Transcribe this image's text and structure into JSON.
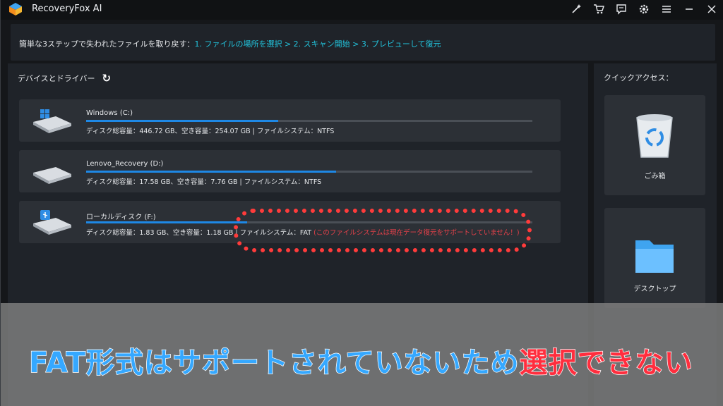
{
  "app": {
    "title": "RecoveryFox AI"
  },
  "titlebar": {
    "icons": [
      "magic-wand-icon",
      "cart-icon",
      "chat-icon",
      "gear-icon",
      "menu-icon",
      "minimize-icon",
      "close-icon"
    ]
  },
  "steps": {
    "prefix": "簡単な3ステップで失われたファイルを取り戻す：",
    "path": "1. ファイルの場所を選択 > 2. スキャン開始 > 3. プレビューして復元"
  },
  "devices": {
    "title": "デバイスとドライバー",
    "drives": [
      {
        "name": "Windows (C:)",
        "info": "ディスク総容量：446.72 GB、空き容量：254.07 GB | ファイルシステム：NTFS",
        "used_fraction": 0.43,
        "icon": "windows-drive-icon",
        "warning": ""
      },
      {
        "name": "Lenovo_Recovery (D:)",
        "info": "ディスク総容量：17.58 GB、空き容量：7.76 GB | ファイルシステム：NTFS",
        "used_fraction": 0.56,
        "icon": "hard-drive-icon",
        "warning": ""
      },
      {
        "name": "ローカルディスク (F:)",
        "info": "ディスク総容量：1.83 GB、空き容量：1.18 GB | ファイルシステム：FAT",
        "used_fraction": 0.36,
        "icon": "usb-drive-icon",
        "warning": "(このファイルシステムは現在データ復元をサポートしていません！)"
      }
    ]
  },
  "quick_access": {
    "title": "クイックアクセス：",
    "items": [
      {
        "label": "ごみ箱",
        "icon": "recycle-bin-icon"
      },
      {
        "label": "デスクトップ",
        "icon": "folder-icon"
      }
    ]
  },
  "banner": {
    "part1": "FAT形式はサポートされていないため",
    "part2": "選択できない"
  },
  "colors": {
    "accent": "#22c4dd",
    "progress": "#1e88e5",
    "warning": "#e8414a",
    "banner_blue": "#35a8ff",
    "banner_red": "#ff2e3e"
  }
}
